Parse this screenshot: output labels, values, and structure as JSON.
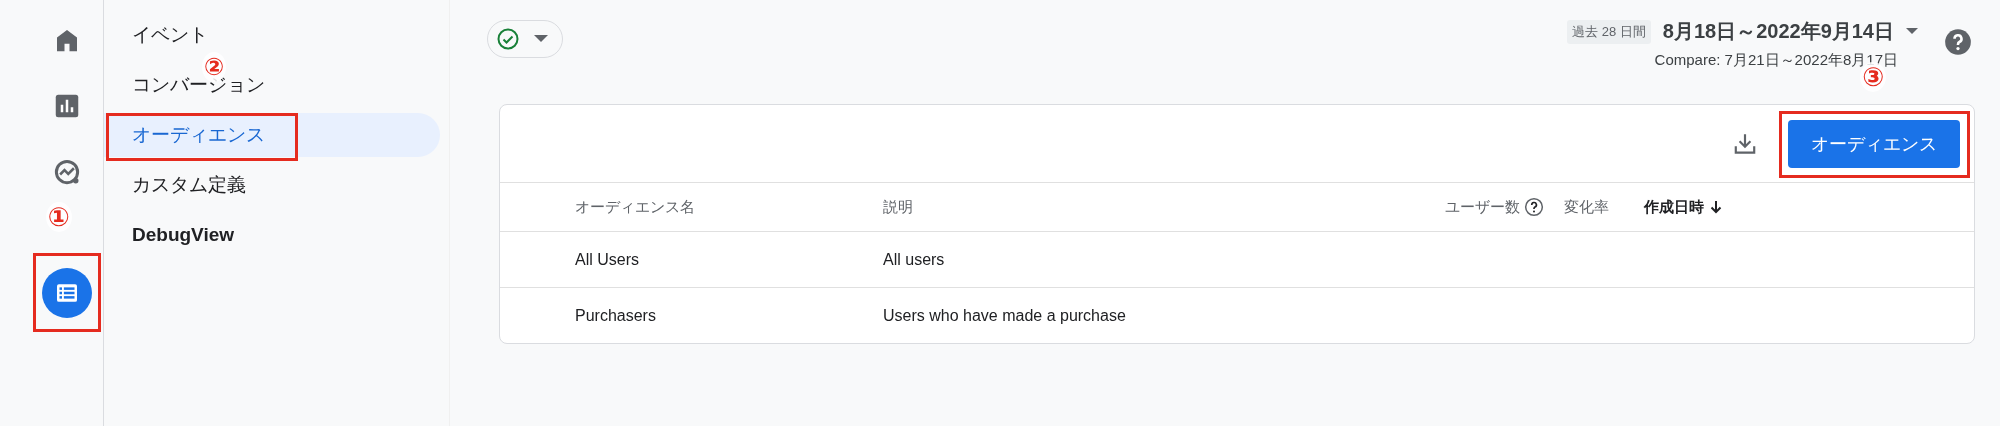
{
  "rail": {
    "items": [
      {
        "kind": "home",
        "selected": false
      },
      {
        "kind": "reports",
        "selected": false
      },
      {
        "kind": "explore",
        "selected": false
      },
      {
        "kind": "configure",
        "selected": true
      }
    ]
  },
  "nav": {
    "items": [
      {
        "label": "イベント",
        "selected": false
      },
      {
        "label": "コンバージョン",
        "selected": false
      },
      {
        "label": "オーディエンス",
        "selected": true
      },
      {
        "label": "カスタム定義",
        "selected": false
      },
      {
        "label": "DebugView",
        "selected": false
      }
    ]
  },
  "header": {
    "date_badge": "過去 28 日間",
    "date_range": "8月18日～2022年9月14日",
    "compare": "Compare: 7月21日～2022年8月17日"
  },
  "card": {
    "button": "オーディエンス",
    "table": {
      "columns": [
        {
          "label": "オーディエンス名",
          "sorted": false,
          "help": false
        },
        {
          "label": "説明",
          "sorted": false,
          "help": false
        },
        {
          "label": "ユーザー数",
          "sorted": false,
          "help": true
        },
        {
          "label": "変化率",
          "sorted": false,
          "help": false
        },
        {
          "label": "作成日時",
          "sorted": true,
          "help": false
        }
      ],
      "rows": [
        [
          "All Users",
          "All users"
        ],
        [
          "Purchasers",
          "Users who have made a purchase"
        ]
      ]
    }
  },
  "annotations": {
    "rail": "①",
    "nav": "②",
    "button": "③"
  }
}
